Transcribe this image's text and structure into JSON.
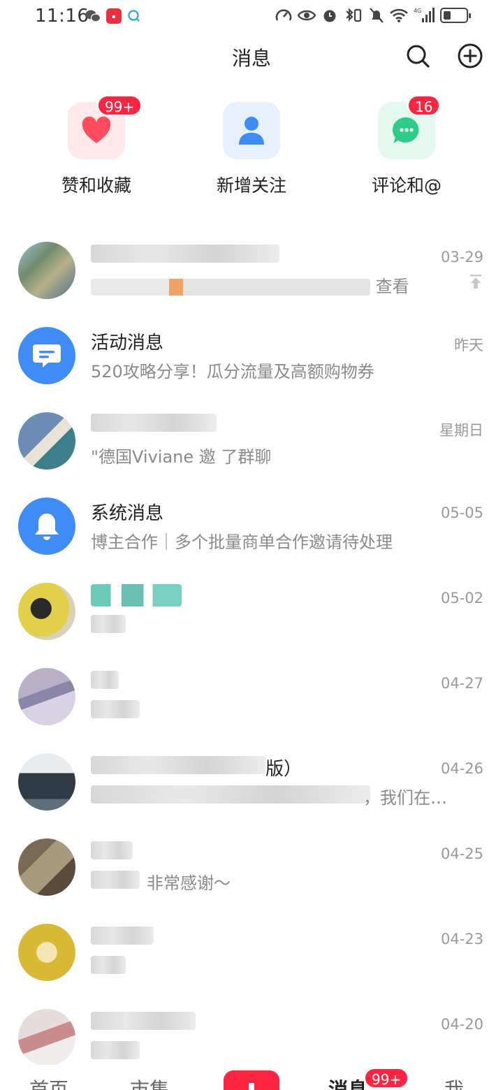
{
  "status_bar": {
    "time": "11:16",
    "network": "4G"
  },
  "header": {
    "title": "消息"
  },
  "quick_entries": [
    {
      "label": "赞和收藏",
      "badge": "99+",
      "icon": "heart-icon",
      "color": "#ff4d5f"
    },
    {
      "label": "新增关注",
      "badge": "",
      "icon": "person-icon",
      "color": "#3f8cf7"
    },
    {
      "label": "评论和@",
      "badge": "16",
      "icon": "chat-bubble-icon",
      "color": "#2ecc8a"
    }
  ],
  "messages": [
    {
      "title": "",
      "subtitle": "查看",
      "time": "03-29",
      "pinned": true
    },
    {
      "title": "活动消息",
      "subtitle": "520攻略分享！瓜分流量及高额购物券",
      "time": "昨天"
    },
    {
      "title": "",
      "subtitle": "\"德国Viviane 邀 了群聊",
      "time": "星期日"
    },
    {
      "title": "系统消息",
      "subtitle": "博主合作｜多个批量商单合作邀请待处理",
      "time": "05-05"
    },
    {
      "title": "",
      "subtitle": "",
      "time": "05-02"
    },
    {
      "title": "",
      "subtitle": "",
      "time": "04-27"
    },
    {
      "title": "版）",
      "subtitle": "，我们在…",
      "time": "04-26"
    },
    {
      "title": "",
      "subtitle": "非常感谢～",
      "time": "04-25"
    },
    {
      "title": "",
      "subtitle": "",
      "time": "04-23"
    },
    {
      "title": "",
      "subtitle": "",
      "time": "04-20"
    }
  ],
  "bottom_nav": {
    "home": "首页",
    "market": "市集",
    "messages": "消息",
    "me": "我",
    "messages_badge": "99+"
  },
  "colors": {
    "accent": "#ff2442",
    "blue": "#3f8cf7"
  }
}
